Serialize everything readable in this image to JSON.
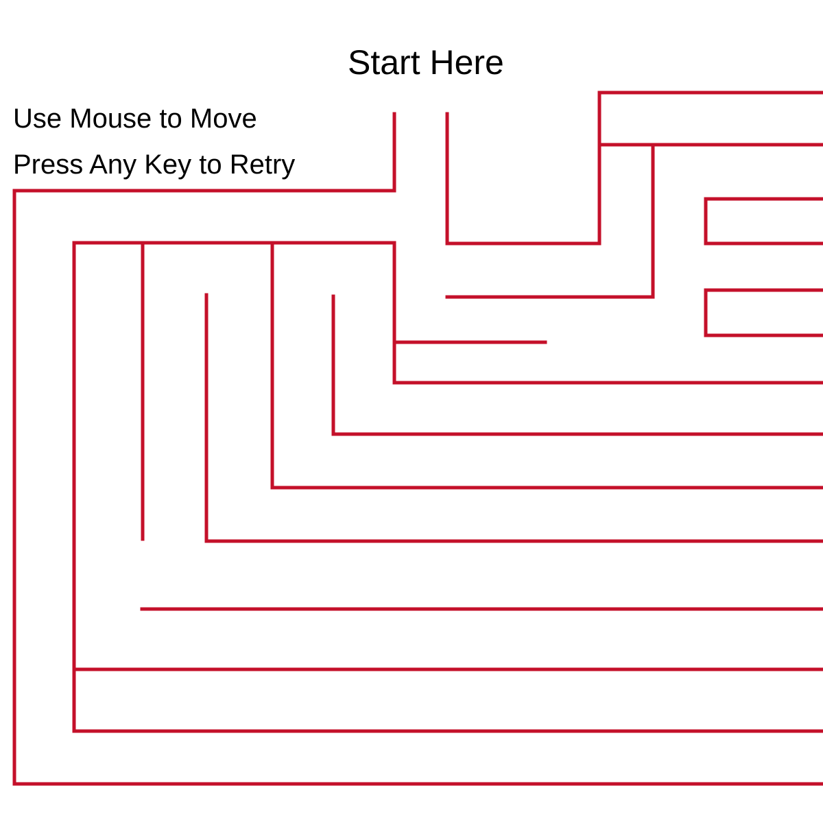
{
  "game": {
    "title": "Start Here",
    "instructions": {
      "move": "Use Mouse to Move",
      "retry": "Press Any Key to Retry"
    }
  },
  "colors": {
    "background": "#ffffff",
    "wall": "#c4102a",
    "text": "#000000"
  }
}
